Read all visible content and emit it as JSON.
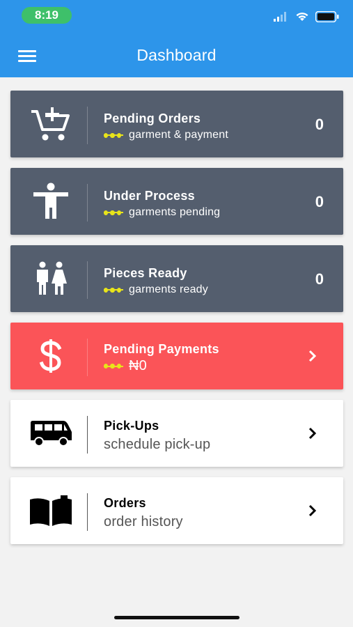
{
  "status_bar": {
    "time": "8:19",
    "time_pill_color": "#3ec06a"
  },
  "header": {
    "title": "Dashboard",
    "background": "#2d95ea",
    "menu_icon": "hamburger-menu-icon"
  },
  "cards": [
    {
      "label": "Pending Orders",
      "sub": "garment & payment",
      "value": "0",
      "icon": "add-to-cart-icon",
      "style": "dark"
    },
    {
      "label": "Under Process",
      "sub": "garments pending",
      "value": "0",
      "icon": "person-icon",
      "style": "dark"
    },
    {
      "label": "Pieces Ready",
      "sub": "garments ready",
      "value": "0",
      "icon": "people-icon",
      "style": "dark"
    },
    {
      "label": "Pending Payments",
      "sub": "₦0",
      "icon": "dollar-icon",
      "style": "red"
    },
    {
      "label": "Pick-Ups",
      "sub": "schedule pick-up",
      "icon": "van-icon",
      "style": "light"
    },
    {
      "label": "Orders",
      "sub": "order history",
      "icon": "book-icon",
      "style": "light"
    }
  ],
  "colors": {
    "dark_card": "#545e6e",
    "red_card": "#fb5458",
    "accent_dots": "#e8e41a"
  }
}
